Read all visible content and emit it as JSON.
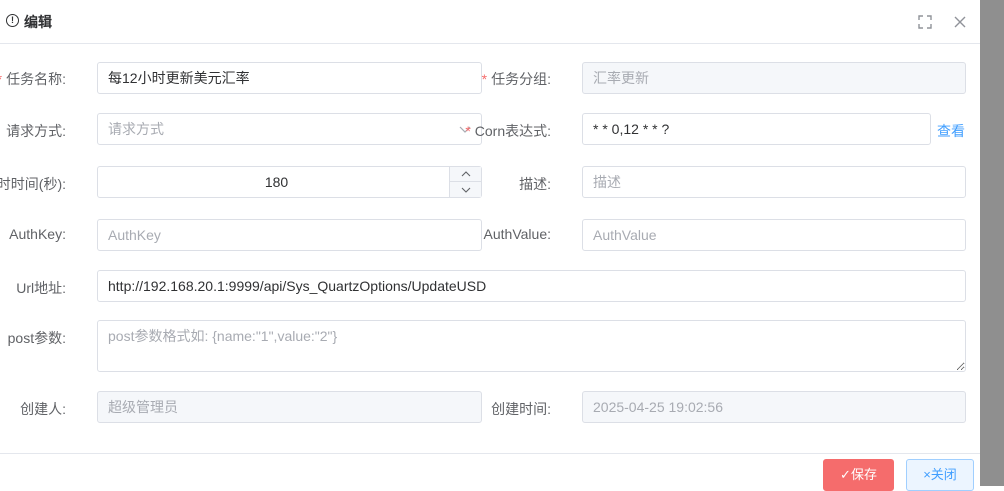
{
  "dialog": {
    "title": "编辑",
    "fullscreen_icon": "fullscreen-icon",
    "close_icon": "close-icon"
  },
  "form": {
    "task_name": {
      "label": "任务名称:",
      "required": "*",
      "value": "每12小时更新美元汇率"
    },
    "task_group": {
      "label": "任务分组:",
      "required": "*",
      "value": "汇率更新"
    },
    "request_method": {
      "label": "请求方式:",
      "placeholder": "请求方式"
    },
    "cron": {
      "label": "Corn表达式:",
      "required": "*",
      "value": "* * 0,12 * * ?",
      "view_link": "查看"
    },
    "timeout": {
      "label": "超时时间(秒):",
      "value": "180"
    },
    "description": {
      "label": "描述:",
      "placeholder": "描述"
    },
    "auth_key": {
      "label": "AuthKey:",
      "placeholder": "AuthKey"
    },
    "auth_value": {
      "label": "AuthValue:",
      "placeholder": "AuthValue"
    },
    "url": {
      "label": "Url地址:",
      "value": "http://192.168.20.1:9999/api/Sys_QuartzOptions/UpdateUSD"
    },
    "post_params": {
      "label": "post参数:",
      "placeholder": "post参数格式如: {name:\"1\",value:\"2\"}"
    },
    "creator": {
      "label": "创建人:",
      "value": "超级管理员"
    },
    "create_time": {
      "label": "创建时间:",
      "value": "2025-04-25 19:02:56"
    }
  },
  "footer": {
    "save_label": "✓保存",
    "close_label": "×关闭"
  },
  "colors": {
    "primary": "#409eff",
    "danger": "#f56c6c",
    "required": "#f56c6c"
  }
}
